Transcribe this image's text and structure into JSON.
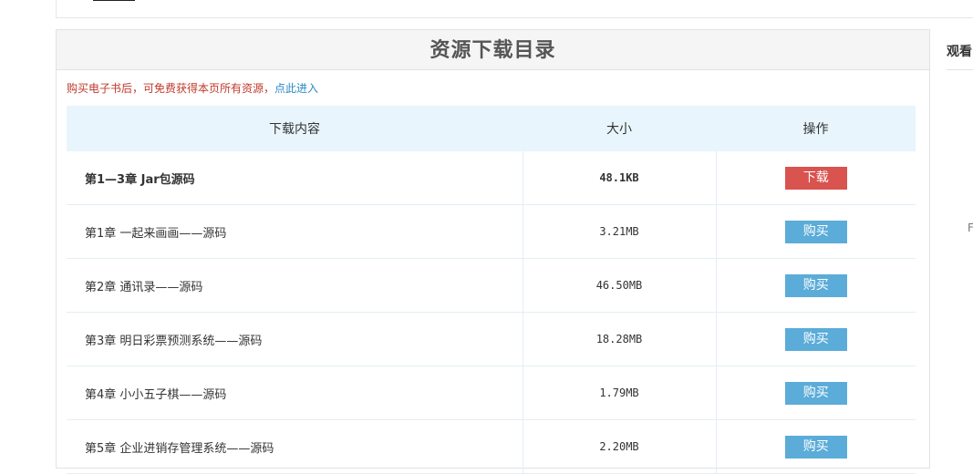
{
  "section": {
    "title": "资源下载目录",
    "notice_text": "购买电子书后，可免费获得本页所有资源，",
    "notice_link": "点此进入"
  },
  "table": {
    "headers": [
      "下载内容",
      "大小",
      "操作"
    ],
    "rows": [
      {
        "name": "第1—3章  Jar包源码",
        "size": "48.1KB",
        "action": "下载"
      },
      {
        "name": "第1章 一起来画画——源码",
        "size": "3.21MB",
        "action": "购买"
      },
      {
        "name": "第2章 通讯录——源码",
        "size": "46.50MB",
        "action": "购买"
      },
      {
        "name": "第3章 明日彩票预测系统——源码",
        "size": "18.28MB",
        "action": "购买"
      },
      {
        "name": "第4章 小小五子棋——源码",
        "size": "1.79MB",
        "action": "购买"
      },
      {
        "name": "第5章 企业进销存管理系统——源码",
        "size": "2.20MB",
        "action": "购买"
      }
    ]
  },
  "sidebar": {
    "title": "观看",
    "fragment": "F"
  },
  "colors": {
    "download_button": "#d9534f",
    "buy_button": "#5bacd8",
    "header_bg": "#e8f5fc",
    "notice": "#c0392b",
    "link": "#2a8ac4"
  }
}
